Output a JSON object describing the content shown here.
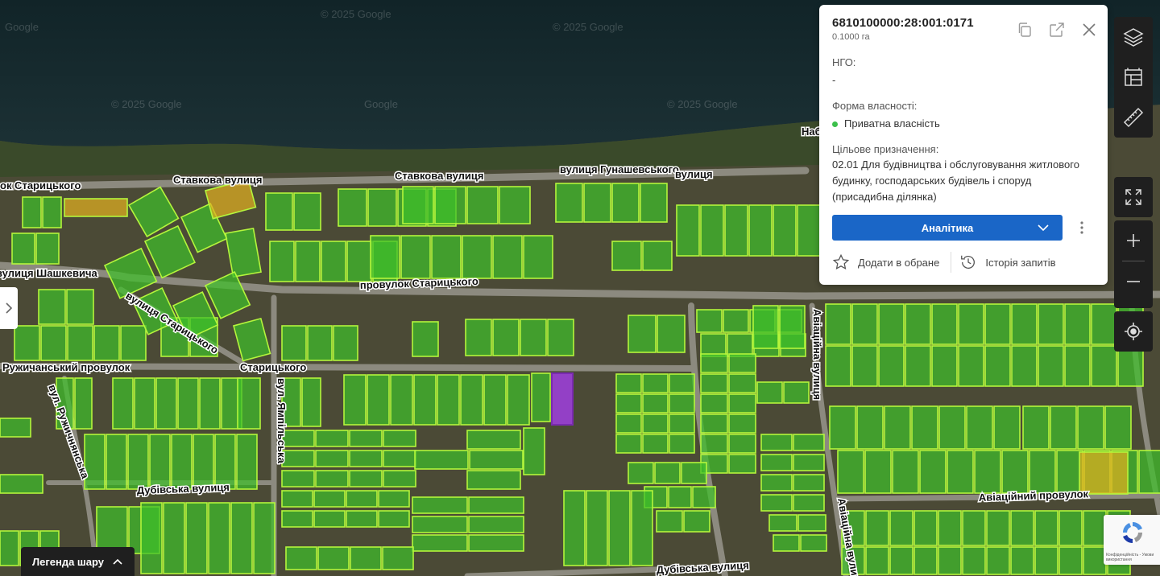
{
  "map": {
    "watermarks": [
      "© 2025 Google",
      "© 2025 Google",
      "© 2025 Google",
      "© 2025 Google",
      "Google",
      "Google"
    ],
    "streets": [
      {
        "label": "Ставкова вулиця"
      },
      {
        "label": "Ставкова вулиця"
      },
      {
        "label": "вулиця Гунашевського"
      },
      {
        "label": "вулиця"
      },
      {
        "label": "ок Старицького"
      },
      {
        "label": "вулиця Шашкевича"
      },
      {
        "label": "провулок Старицького"
      },
      {
        "label": "вулиця Старицького"
      },
      {
        "label": "Старицького"
      },
      {
        "label": "Ружичанський провулок"
      },
      {
        "label": "вул. Ямпільська"
      },
      {
        "label": "вул. Ружичнянська"
      },
      {
        "label": "Дубівська вулиця"
      },
      {
        "label": "Авіаційна вулиця"
      },
      {
        "label": "Авіаційна вулиця"
      },
      {
        "label": "Авіаційний провулок"
      },
      {
        "label": "Дубівська вулиця"
      },
      {
        "label": "Наб"
      }
    ]
  },
  "panel": {
    "cadastral_number": "6810100000:28:001:0171",
    "area": "0.1000 га",
    "ngo_label": "НГО:",
    "ngo_value": "-",
    "ownership_label": "Форма власності:",
    "ownership_value": "Приватна власність",
    "ownership_color": "#3cc04b",
    "purpose_label": "Цільове призначення:",
    "purpose_value": "02.01 Для будівництва і обслуговування житлового будинку, господарських будівель і споруд (присадибна ділянка)",
    "analytics_button": "Аналітика",
    "favorite_label": "Додати в обране",
    "history_label": "Історія запитів",
    "icons": [
      "copy-icon",
      "external-link-icon",
      "close-icon"
    ]
  },
  "toolbar": {
    "icons": [
      "layers-icon",
      "cadastre-map-icon",
      "ruler-icon",
      "fullscreen-icon",
      "zoom-in-icon",
      "zoom-out-icon",
      "locate-icon"
    ]
  },
  "legend": {
    "label": "Легенда шару"
  },
  "recaptcha": {
    "text": "Конфіденційність - Умови використання"
  },
  "colors": {
    "parcel_fill": "#3fbf2a",
    "parcel_stroke": "#b4f53c",
    "selected_parcel": "#9b3fd6",
    "other_parcel": "#e0b020",
    "primary": "#1a66c7"
  }
}
